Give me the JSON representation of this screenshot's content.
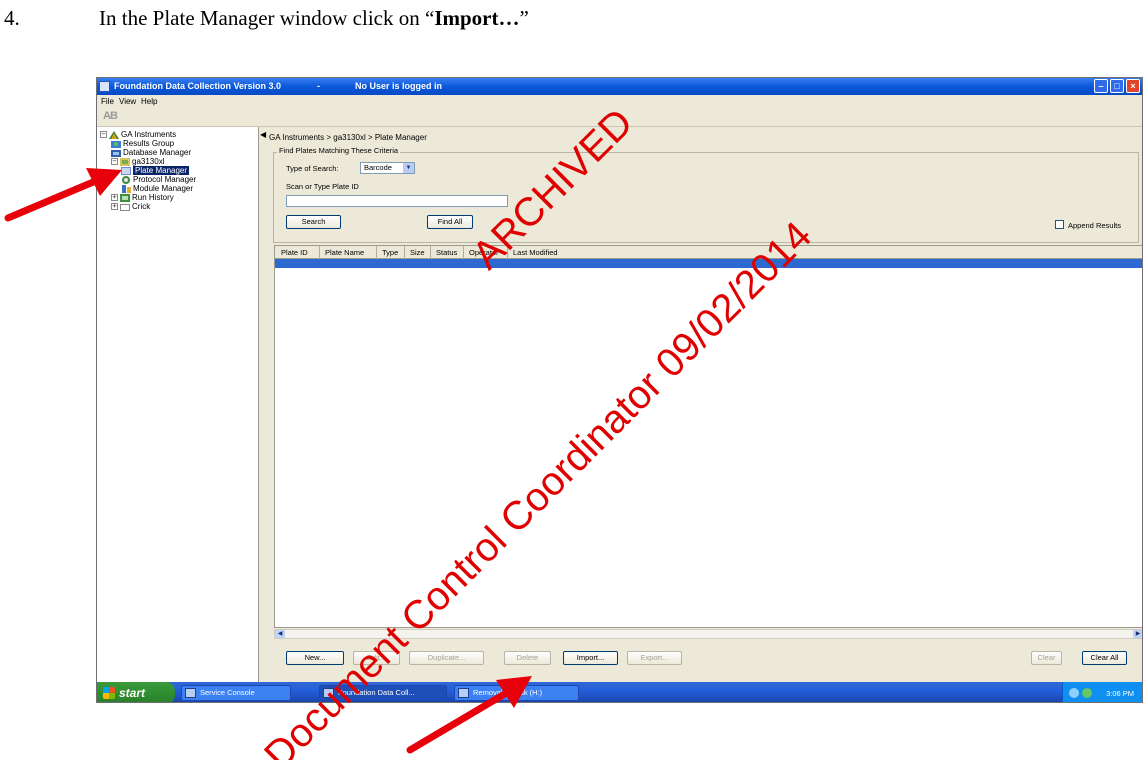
{
  "instruction": {
    "number": "4.",
    "text_before": "In the Plate Manager window click on “",
    "bold": "Import…",
    "text_after": "”"
  },
  "window": {
    "title": "Foundation Data Collection Version 3.0",
    "separator": "-",
    "user_status": "No User is logged in"
  },
  "menu": [
    "File",
    "View",
    "Help"
  ],
  "toolbar": {
    "logo": "AB"
  },
  "tree": {
    "root": "GA Instruments",
    "results_group": "Results Group",
    "database_manager": "Database Manager",
    "instrument": "ga3130xl",
    "plate_manager": "Plate Manager",
    "protocol_manager": "Protocol Manager",
    "module_manager": "Module Manager",
    "run_history": "Run History",
    "crick": "Crick"
  },
  "breadcrumb": "GA Instruments > ga3130xl > Plate Manager",
  "criteria": {
    "legend": "Find Plates Matching These Criteria",
    "type_label": "Type of Search:",
    "type_value": "Barcode",
    "scan_label": "Scan or Type Plate ID",
    "plate_id_value": "",
    "search_button": "Search",
    "find_all_button": "Find All",
    "append_results": "Append Results"
  },
  "table": {
    "columns": [
      "Plate ID",
      "Plate Name",
      "Type",
      "Size",
      "Status",
      "Operator",
      "Last Modified"
    ]
  },
  "buttons": {
    "new": "New...",
    "edit": "Edit...",
    "duplicate": "Duplicate...",
    "delete": "Delete",
    "import": "Import...",
    "export": "Export...",
    "clear": "Clear",
    "clear_all": "Clear All"
  },
  "taskbar": {
    "start": "start",
    "tasks": [
      "Service Console",
      "Foundation Data Coll...",
      "Removable Disk (H:)"
    ],
    "clock": "3:06 PM"
  },
  "watermark": {
    "line1": "ARCHIVED",
    "line2": "Document Control Coordinator 09/02/2014"
  },
  "colors": {
    "watermark": "#e00000",
    "arrow": "#e8000b",
    "selection": "#0a246a",
    "xp_blue": "#0a58d9"
  }
}
